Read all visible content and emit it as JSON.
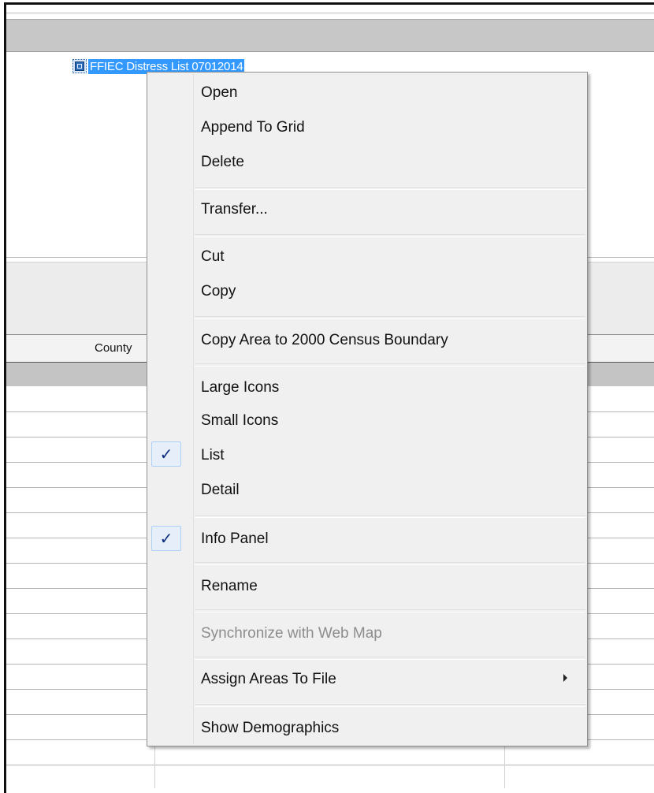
{
  "file_list": {
    "selected_item_label": "FFIEC Distress List 07012014"
  },
  "grid": {
    "columns": [
      "County"
    ]
  },
  "context_menu": {
    "items": [
      {
        "label": "Open",
        "enabled": true
      },
      {
        "label": "Append To Grid",
        "enabled": true
      },
      {
        "label": "Delete",
        "enabled": true
      },
      {
        "label": "Transfer...",
        "enabled": true
      },
      {
        "label": "Cut",
        "enabled": true
      },
      {
        "label": "Copy",
        "enabled": true
      },
      {
        "label": "Copy Area to 2000 Census Boundary",
        "enabled": true
      },
      {
        "label": "Large Icons",
        "enabled": true
      },
      {
        "label": "Small Icons",
        "enabled": true
      },
      {
        "label": "List",
        "enabled": true,
        "checked": true
      },
      {
        "label": "Detail",
        "enabled": true
      },
      {
        "label": "Info Panel",
        "enabled": true,
        "checked": true
      },
      {
        "label": "Rename",
        "enabled": true
      },
      {
        "label": "Synchronize with Web Map",
        "enabled": false
      },
      {
        "label": "Assign Areas To File",
        "enabled": true,
        "has_submenu": true
      },
      {
        "label": "Show Demographics",
        "enabled": true
      }
    ],
    "check_glyph": "✓"
  },
  "colors": {
    "selection": "#3399ff",
    "menu_background": "#f0f0f0",
    "check_highlight": "#e6eefa",
    "disabled_text": "#8d8d8d"
  }
}
